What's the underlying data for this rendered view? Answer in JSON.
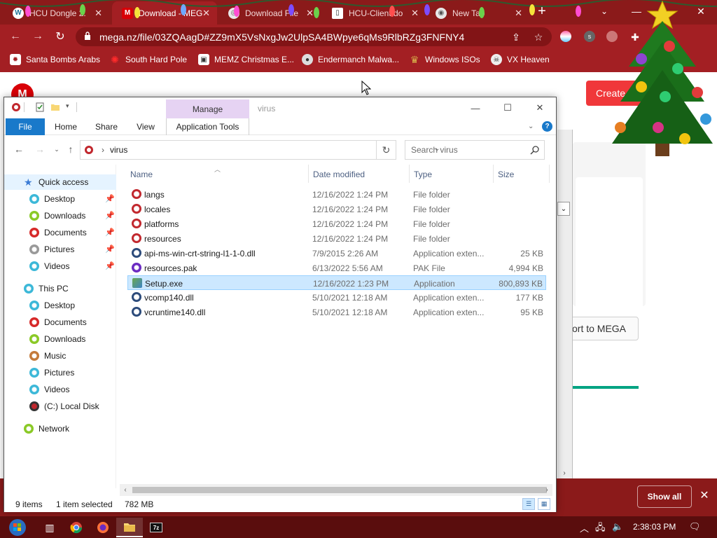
{
  "browser": {
    "tabs": [
      {
        "label": "HCU Dongle 2.",
        "icon": "wordpress-icon",
        "active": false
      },
      {
        "label": "Download - MEG",
        "icon": "mega-icon",
        "active": true
      },
      {
        "label": "Download File",
        "icon": "chrome-page-icon",
        "active": false
      },
      {
        "label": "HCU-Client do",
        "icon": "document-icon",
        "active": false
      },
      {
        "label": "New Tab",
        "icon": "chrome-icon",
        "active": false
      }
    ],
    "url": "mega.nz/file/03ZQAagD#ZZ9mX5VsNxgJw2UlpSA4BWpye6qMs9RlbRZg3FNFNY4",
    "bookmarks": [
      {
        "label": "Santa Bombs Arabs",
        "icon": "bomb-icon"
      },
      {
        "label": "South Hard Pole",
        "icon": "virus-icon"
      },
      {
        "label": "MEMZ Christmas E...",
        "icon": "memz-icon"
      },
      {
        "label": "Endermanch Malwa...",
        "icon": "raccoon-icon"
      },
      {
        "label": "Windows ISOs",
        "icon": "trophy-icon"
      },
      {
        "label": "VX Heaven",
        "icon": "vx-icon"
      }
    ]
  },
  "mega": {
    "logo": "M",
    "create_label": "Create",
    "import_label": "ort to MEGA",
    "download_progress": 1.0
  },
  "downloads_bar": {
    "show_all": "Show all"
  },
  "explorer": {
    "manage_tab": "Manage",
    "title": "virus",
    "ribbon_tabs": [
      "File",
      "Home",
      "Share",
      "View",
      "Application Tools"
    ],
    "path_folder": "virus",
    "search_placeholder": "Search virus",
    "nav": {
      "quick_access": "Quick access",
      "quick_items": [
        "Desktop",
        "Downloads",
        "Documents",
        "Pictures",
        "Videos"
      ],
      "this_pc": "This PC",
      "pc_items": [
        "Desktop",
        "Documents",
        "Downloads",
        "Music",
        "Pictures",
        "Videos",
        "(C:) Local Disk"
      ],
      "network": "Network"
    },
    "columns": {
      "name": "Name",
      "date": "Date modified",
      "type": "Type",
      "size": "Size"
    },
    "files": [
      {
        "name": "langs",
        "date": "12/16/2022 1:24 PM",
        "type": "File folder",
        "size": "",
        "icon": "folder-icon"
      },
      {
        "name": "locales",
        "date": "12/16/2022 1:24 PM",
        "type": "File folder",
        "size": "",
        "icon": "folder-icon"
      },
      {
        "name": "platforms",
        "date": "12/16/2022 1:24 PM",
        "type": "File folder",
        "size": "",
        "icon": "folder-icon"
      },
      {
        "name": "resources",
        "date": "12/16/2022 1:24 PM",
        "type": "File folder",
        "size": "",
        "icon": "folder-icon"
      },
      {
        "name": "api-ms-win-crt-string-l1-1-0.dll",
        "date": "7/9/2015 2:26 AM",
        "type": "Application exten...",
        "size": "25 KB",
        "icon": "dll-icon"
      },
      {
        "name": "resources.pak",
        "date": "6/13/2022 5:56 AM",
        "type": "PAK File",
        "size": "4,994 KB",
        "icon": "pak-icon"
      },
      {
        "name": "Setup.exe",
        "date": "12/16/2022 1:23 PM",
        "type": "Application",
        "size": "800,893 KB",
        "icon": "exe-icon",
        "selected": true
      },
      {
        "name": "vcomp140.dll",
        "date": "5/10/2021 12:18 AM",
        "type": "Application exten...",
        "size": "177 KB",
        "icon": "dll-icon"
      },
      {
        "name": "vcruntime140.dll",
        "date": "5/10/2021 12:18 AM",
        "type": "Application exten...",
        "size": "95 KB",
        "icon": "dll-icon"
      }
    ],
    "status": {
      "count": "9 items",
      "selection": "1 item selected",
      "selection_size": "782 MB"
    }
  },
  "taskbar": {
    "clock": "2:38:03 PM",
    "apps": [
      "start-orb-icon",
      "task-view-icon",
      "chrome-icon",
      "firefox-icon",
      "file-explorer-icon",
      "7zip-icon"
    ]
  },
  "colors": {
    "chrome_frame": "#8b1a1a",
    "chrome_toolbar": "#a31f23",
    "explorer_file_tab": "#1979ca",
    "selection": "#cce8ff",
    "manage_tab": "#e6d3f3",
    "mega_red": "#f0373a"
  }
}
